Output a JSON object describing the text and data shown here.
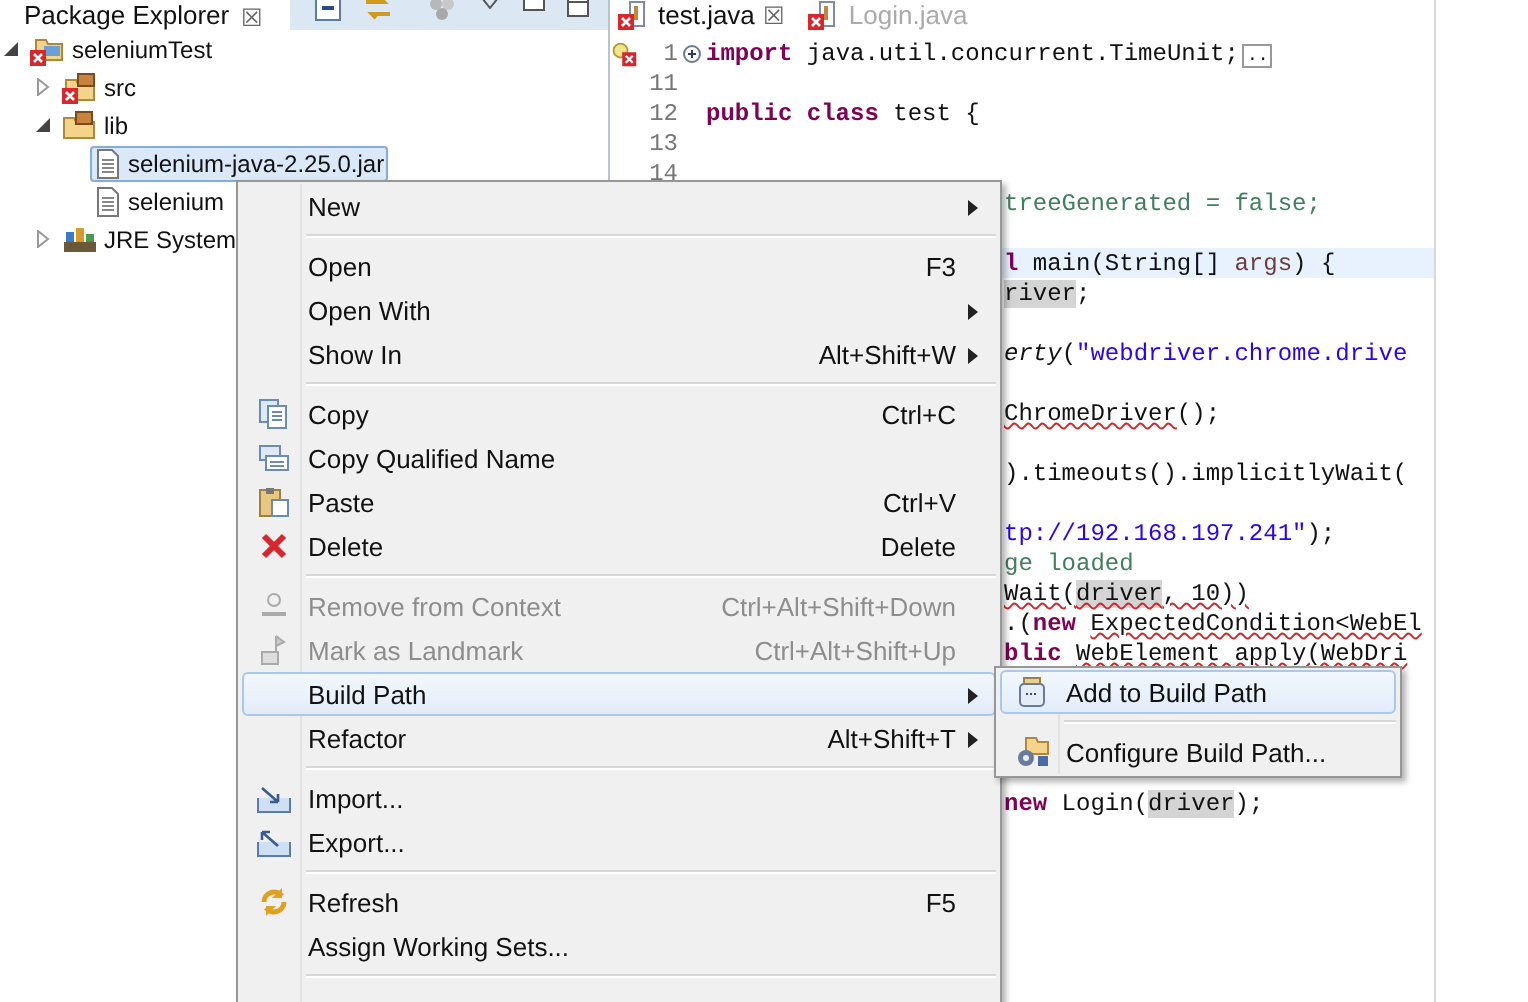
{
  "explorer": {
    "tab": {
      "label": "Package Explorer",
      "close": "☒"
    },
    "tree": [
      {
        "label": "seleniumTest",
        "kind": "project",
        "expanded": true,
        "selected": false,
        "children": [
          {
            "label": "src",
            "kind": "package_folder",
            "expanded": false,
            "selected": false
          },
          {
            "label": "lib",
            "kind": "folder",
            "expanded": true,
            "selected": false,
            "children": [
              {
                "label": "selenium-java-2.25.0.jar",
                "kind": "jar",
                "selected": true
              },
              {
                "label": "selenium",
                "kind": "jar",
                "selected": false
              }
            ]
          },
          {
            "label": "JRE System",
            "kind": "library",
            "expanded": false,
            "selected": false
          }
        ]
      }
    ]
  },
  "editor": {
    "tabs": [
      {
        "label": "test.java",
        "close": "☒",
        "selected": true
      },
      {
        "label": "Login.java",
        "selected": false
      }
    ],
    "lines": [
      {
        "number": "1",
        "tokens": [
          {
            "text": "import",
            "kind": "keyword"
          },
          {
            "text": " java.util.concurrent.TimeUnit;",
            "kind": "plain"
          }
        ],
        "folded": true,
        "folded_marker": ".."
      },
      {
        "number": "11"
      },
      {
        "number": "12",
        "tokens": [
          {
            "text": "public class",
            "kind": "keyword"
          },
          {
            "text": " test {",
            "kind": "plain"
          }
        ]
      },
      {
        "number": "13"
      },
      {
        "number": "14"
      }
    ],
    "fragments": [
      {
        "kind": "code",
        "tokens": [
          {
            "text": "treeGenerated = false;",
            "kind": "comment"
          }
        ]
      },
      {
        "kind": "blank"
      },
      {
        "kind": "code",
        "current": true,
        "tokens": [
          {
            "text": "l",
            "kind": "keyword"
          },
          {
            "text": " main(String[] ",
            "kind": "plain"
          },
          {
            "text": "args",
            "kind": "local"
          },
          {
            "text": ") {",
            "kind": "plain"
          }
        ]
      },
      {
        "kind": "code",
        "tokens": [
          {
            "text": "river",
            "kind": "occurrence"
          },
          {
            "text": ";",
            "kind": "plain"
          }
        ]
      },
      {
        "kind": "blank"
      },
      {
        "kind": "code",
        "tokens": [
          {
            "text": "erty",
            "kind": "static"
          },
          {
            "text": "(",
            "kind": "plain"
          },
          {
            "text": "\"webdriver.chrome.drive",
            "kind": "string"
          }
        ]
      },
      {
        "kind": "blank"
      },
      {
        "kind": "code",
        "tokens": [
          {
            "text": "ChromeDriver",
            "kind": "error"
          },
          {
            "text": "();",
            "kind": "plain"
          }
        ]
      },
      {
        "kind": "blank"
      },
      {
        "kind": "code",
        "tokens": [
          {
            "text": ").timeouts().implicitlyWait(",
            "kind": "plain"
          }
        ]
      },
      {
        "kind": "blank"
      },
      {
        "kind": "code",
        "tokens": [
          {
            "text": "tp://192.168.197.241\"",
            "kind": "string"
          },
          {
            "text": ");",
            "kind": "plain"
          }
        ]
      },
      {
        "kind": "code",
        "tokens": [
          {
            "text": "ge loaded",
            "kind": "comment"
          }
        ]
      },
      {
        "kind": "code",
        "tokens": [
          {
            "text": "Wait(",
            "kind": "error"
          },
          {
            "text": "driver",
            "kind": "occurrence_error"
          },
          {
            "text": ", 10))",
            "kind": "error"
          }
        ]
      },
      {
        "kind": "code",
        "tokens": [
          {
            "text": ".(",
            "kind": "plain"
          },
          {
            "text": "new ",
            "kind": "keyword"
          },
          {
            "text": "ExpectedCondition<WebEl",
            "kind": "error"
          }
        ]
      },
      {
        "kind": "code",
        "tokens": [
          {
            "text": "blic ",
            "kind": "keyword"
          },
          {
            "text": "WebElement apply(WebDri",
            "kind": "error"
          }
        ]
      },
      {
        "kind": "blank"
      },
      {
        "kind": "blank"
      },
      {
        "kind": "blank"
      },
      {
        "kind": "blank"
      },
      {
        "kind": "code",
        "tokens": [
          {
            "text": "new",
            "kind": "keyword"
          },
          {
            "text": " Login(",
            "kind": "plain"
          },
          {
            "text": "driver",
            "kind": "occurrence"
          },
          {
            "text": ");",
            "kind": "plain"
          }
        ]
      }
    ]
  },
  "menu": {
    "items": [
      {
        "label": "New",
        "submenu": true,
        "disabled": false,
        "selected": false
      },
      {
        "label": "Open",
        "shortcut": "F3",
        "separator_before": true,
        "disabled": false,
        "selected": false
      },
      {
        "label": "Open With",
        "submenu": true,
        "disabled": false,
        "selected": false
      },
      {
        "label": "Show In",
        "shortcut": "Alt+Shift+W",
        "submenu": true,
        "disabled": false,
        "selected": false
      },
      {
        "label": "Copy",
        "shortcut": "Ctrl+C",
        "separator_before": true,
        "disabled": false,
        "selected": false
      },
      {
        "label": "Copy Qualified Name",
        "disabled": false,
        "selected": false
      },
      {
        "label": "Paste",
        "shortcut": "Ctrl+V",
        "disabled": false,
        "selected": false
      },
      {
        "label": "Delete",
        "shortcut": "Delete",
        "disabled": false,
        "selected": false
      },
      {
        "label": "Remove from Context",
        "shortcut": "Ctrl+Alt+Shift+Down",
        "separator_before": true,
        "disabled": true,
        "selected": false
      },
      {
        "label": "Mark as Landmark",
        "shortcut": "Ctrl+Alt+Shift+Up",
        "disabled": true,
        "selected": false
      },
      {
        "label": "Build Path",
        "submenu": true,
        "disabled": false,
        "selected": true
      },
      {
        "label": "Refactor",
        "shortcut": "Alt+Shift+T",
        "submenu": true,
        "disabled": false,
        "selected": false
      },
      {
        "label": "Import...",
        "separator_before": true,
        "disabled": false,
        "selected": false
      },
      {
        "label": "Export...",
        "disabled": false,
        "selected": false
      },
      {
        "label": "Refresh",
        "shortcut": "F5",
        "separator_before": true,
        "disabled": false,
        "selected": false
      },
      {
        "label": "Assign Working Sets...",
        "separator_after": true,
        "disabled": false,
        "selected": false
      }
    ]
  },
  "submenu": {
    "items": [
      {
        "label": "Add to Build Path",
        "selected": true
      },
      {
        "label": "Configure Build Path...",
        "separator_before": true,
        "selected": false
      }
    ]
  }
}
